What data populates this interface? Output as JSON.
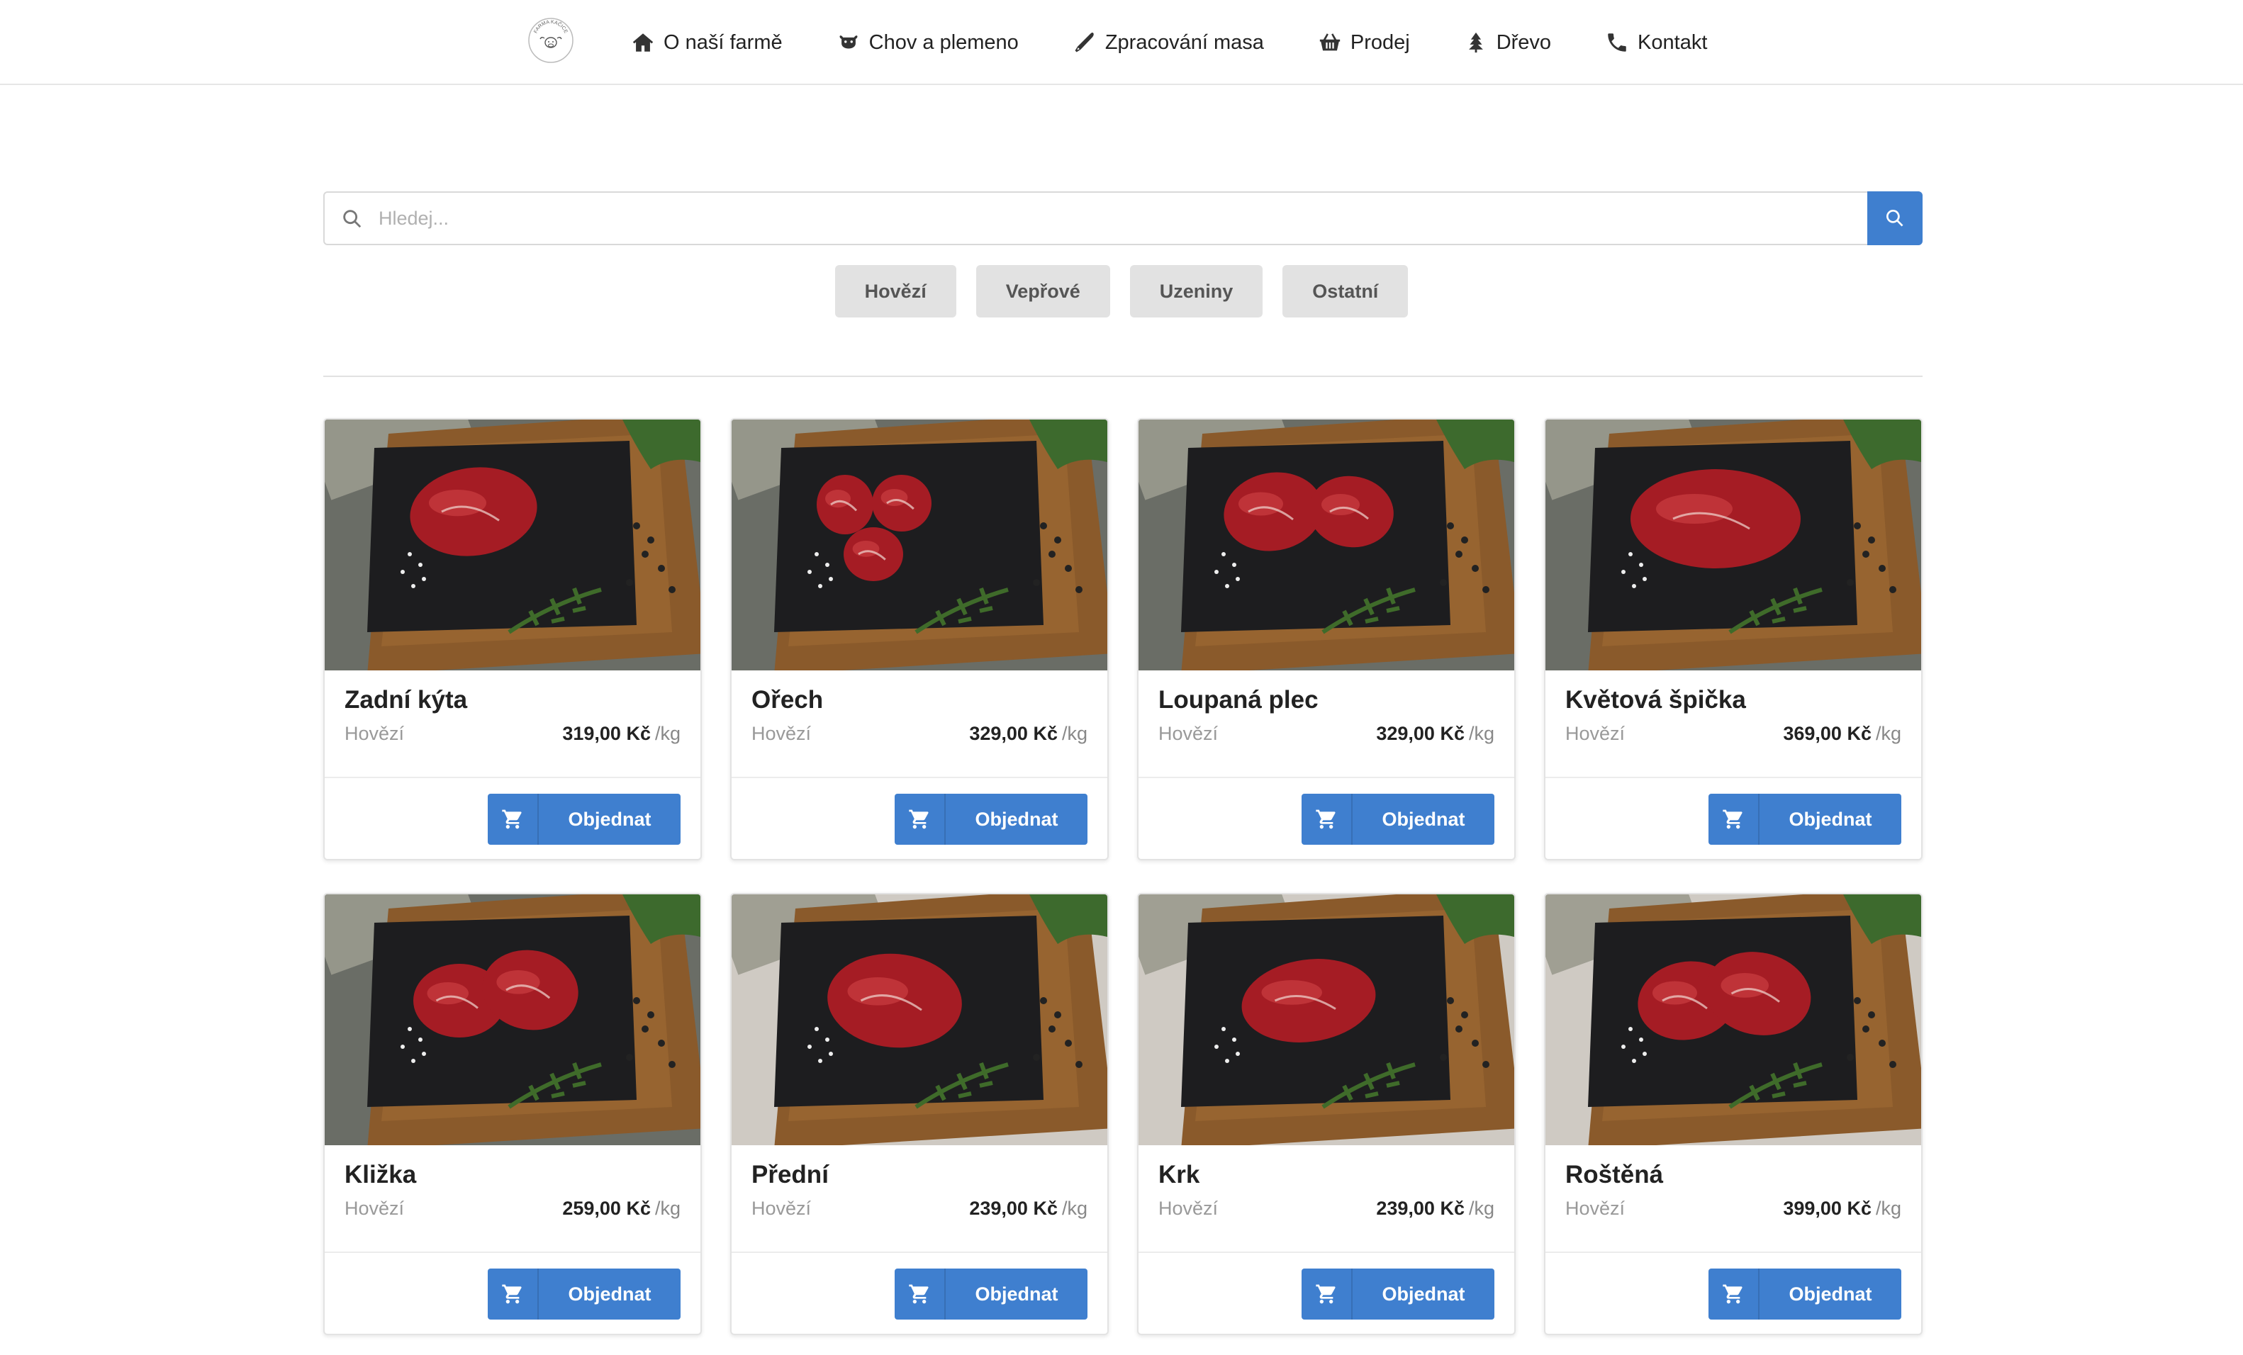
{
  "nav": {
    "logo_text": "FARMA KAČICE",
    "items": [
      {
        "label": "O naší farmě",
        "icon": "home-icon"
      },
      {
        "label": "Chov a plemeno",
        "icon": "cow-icon"
      },
      {
        "label": "Zpracování masa",
        "icon": "knife-icon"
      },
      {
        "label": "Prodej",
        "icon": "basket-icon"
      },
      {
        "label": "Dřevo",
        "icon": "tree-icon"
      },
      {
        "label": "Kontakt",
        "icon": "phone-icon"
      }
    ]
  },
  "search": {
    "placeholder": "Hledej...",
    "value": ""
  },
  "filters": [
    "Hovězí",
    "Vepřové",
    "Uzeniny",
    "Ostatní"
  ],
  "products": [
    {
      "name": "Zadní kýta",
      "category": "Hovězí",
      "price": "319,00 Kč",
      "unit": "/kg",
      "button": "Objednat"
    },
    {
      "name": "Ořech",
      "category": "Hovězí",
      "price": "329,00 Kč",
      "unit": "/kg",
      "button": "Objednat"
    },
    {
      "name": "Loupaná plec",
      "category": "Hovězí",
      "price": "329,00 Kč",
      "unit": "/kg",
      "button": "Objednat"
    },
    {
      "name": "Květová špička",
      "category": "Hovězí",
      "price": "369,00 Kč",
      "unit": "/kg",
      "button": "Objednat"
    },
    {
      "name": "Kližka",
      "category": "Hovězí",
      "price": "259,00 Kč",
      "unit": "/kg",
      "button": "Objednat"
    },
    {
      "name": "Přední",
      "category": "Hovězí",
      "price": "239,00 Kč",
      "unit": "/kg",
      "button": "Objednat"
    },
    {
      "name": "Krk",
      "category": "Hovězí",
      "price": "239,00 Kč",
      "unit": "/kg",
      "button": "Objednat"
    },
    {
      "name": "Roštěná",
      "category": "Hovězí",
      "price": "399,00 Kč",
      "unit": "/kg",
      "button": "Objednat"
    }
  ],
  "colors": {
    "accent": "#3f7fcf",
    "filter_bg": "#e2e2e2"
  }
}
